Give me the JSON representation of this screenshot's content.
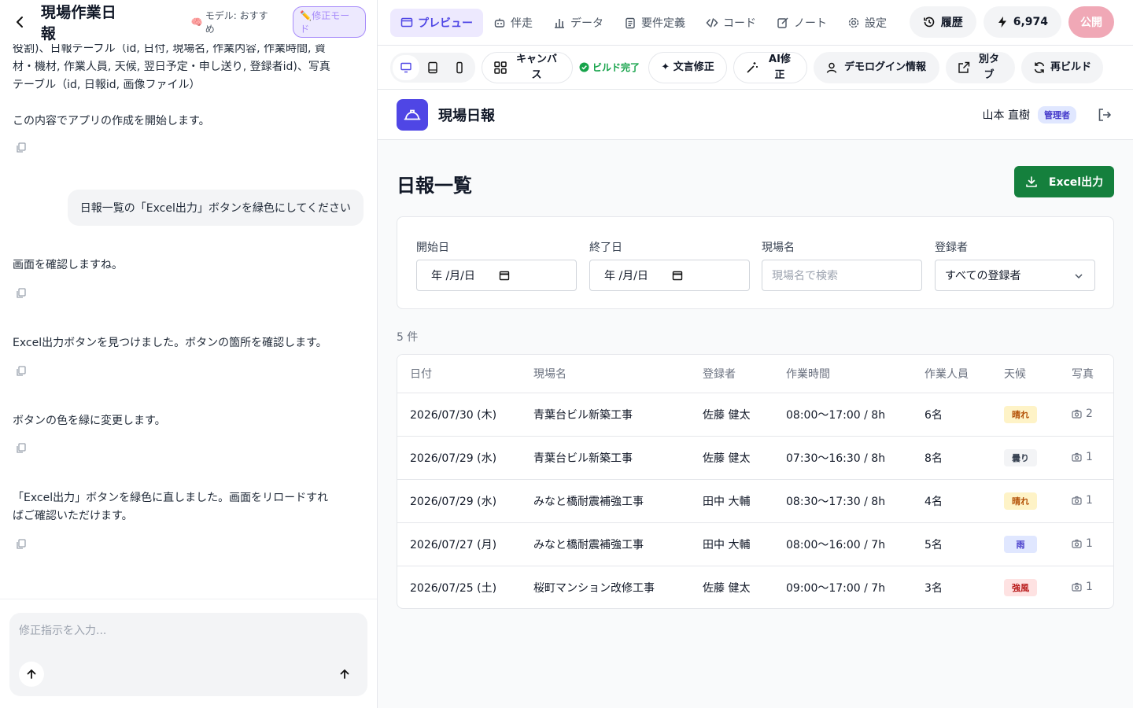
{
  "left": {
    "title": "現場作業日報",
    "model_label": "モデル: おすすめ",
    "mode_badge": "✏️修正モード",
    "messages": [
      "役割)、日報テーブル（id, 日付, 現場名, 作業内容, 作業時間, 資\n材・機材, 作業人員, 天候, 翌日予定・申し送り, 登録者id)、写真\nテーブル（id, 日報id, 画像ファイル）\n\nこの内容でアプリの作成を開始します。",
      "画面を確認しますね。",
      "Excel出力ボタンを見つけました。ボタンの箇所を確認します。",
      "ボタンの色を緑に変更します。",
      "「Excel出力」ボタンを緑色に直しました。画面をリロードすれ\nばご確認いただけます。"
    ],
    "user_message": "日報一覧の「Excel出力」ボタンを緑色にしてください",
    "input_placeholder": "修正指示を入力..."
  },
  "topnav": {
    "tabs": [
      "プレビュー",
      "伴走",
      "データ",
      "要件定義",
      "コード",
      "ノート",
      "設定"
    ],
    "history": "履歴",
    "credits": "6,974",
    "publish": "公開"
  },
  "toolbar": {
    "canvas": "キャンバス",
    "build_status": "ビルド完了",
    "text_fix": "✦ 文言修正",
    "ai_fix": "AI修正",
    "demo_login": "デモログイン情報",
    "new_tab": "別タブ",
    "rebuild": "再ビルド"
  },
  "app": {
    "name": "現場日報",
    "user_name": "山本 直樹",
    "role": "管理者",
    "page_title": "日報一覧",
    "excel_button": "Excel出力",
    "filters": {
      "start_label": "開始日",
      "start_value": "年 /月/日",
      "end_label": "終了日",
      "end_value": "年 /月/日",
      "site_label": "現場名",
      "site_placeholder": "現場名で検索",
      "registrant_label": "登録者",
      "registrant_value": "すべての登録者"
    },
    "count": "5 件",
    "table": {
      "headers": [
        "日付",
        "現場名",
        "登録者",
        "作業時間",
        "作業人員",
        "天候",
        "写真"
      ],
      "rows": [
        {
          "date": "2026/07/30 (木)",
          "site": "青葉台ビル新築工事",
          "registrant": "佐藤 健太",
          "hours": "08:00〜17:00 / 8h",
          "staff": "6名",
          "weather": "晴れ",
          "photos": "2"
        },
        {
          "date": "2026/07/29 (水)",
          "site": "青葉台ビル新築工事",
          "registrant": "佐藤 健太",
          "hours": "07:30〜16:30 / 8h",
          "staff": "8名",
          "weather": "曇り",
          "photos": "1"
        },
        {
          "date": "2026/07/29 (水)",
          "site": "みなと橋耐震補強工事",
          "registrant": "田中 大輔",
          "hours": "08:30〜17:30 / 8h",
          "staff": "4名",
          "weather": "晴れ",
          "photos": "1"
        },
        {
          "date": "2026/07/27 (月)",
          "site": "みなと橋耐震補強工事",
          "registrant": "田中 大輔",
          "hours": "08:00〜16:00 / 7h",
          "staff": "5名",
          "weather": "雨",
          "photos": "1"
        },
        {
          "date": "2026/07/25 (土)",
          "site": "桜町マンション改修工事",
          "registrant": "佐藤 健太",
          "hours": "09:00〜17:00 / 7h",
          "staff": "3名",
          "weather": "強風",
          "photos": "1"
        }
      ]
    }
  },
  "colors": {
    "accent": "#4f46e5",
    "excel_green": "#15803d",
    "sunny": "#fef3c7",
    "cloudy": "#f3f4f6",
    "rain": "#e0e7ff",
    "wind": "#fee2e2"
  }
}
